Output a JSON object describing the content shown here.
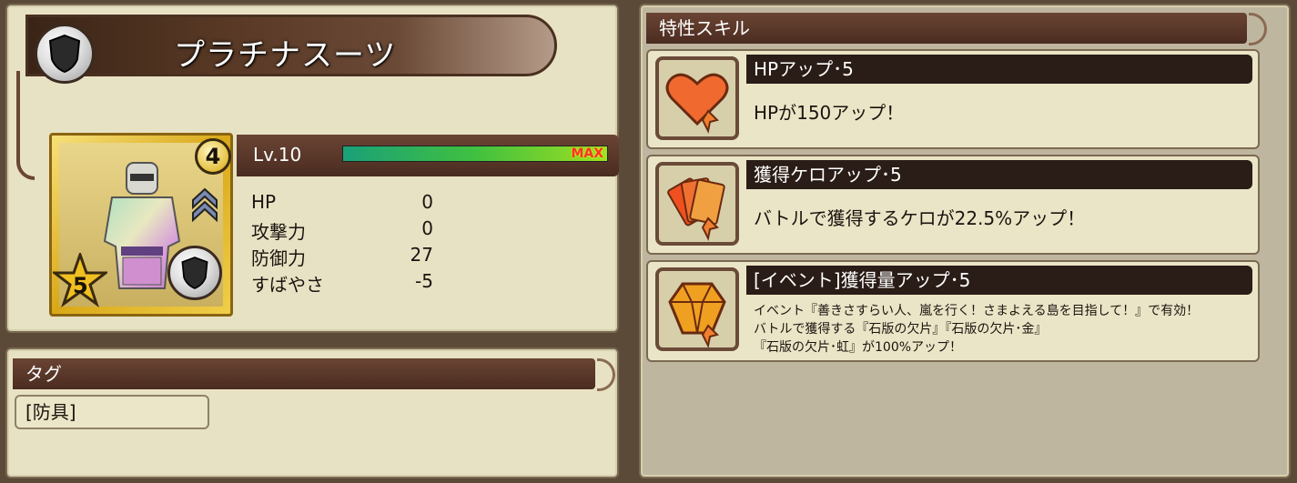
{
  "item": {
    "name": "プラチナスーツ",
    "level": "Lv.10",
    "max_label": "MAX",
    "exp_fraction": 1.0,
    "rank": "4",
    "stars": "5",
    "stats": [
      {
        "label": "HP",
        "value": "0"
      },
      {
        "label": "攻撃力",
        "value": "0"
      },
      {
        "label": "防御力",
        "value": "27"
      },
      {
        "label": "すばやさ",
        "value": "-5"
      }
    ]
  },
  "tags": {
    "header": "タグ",
    "items": [
      "[防具]"
    ]
  },
  "skills": {
    "header": "特性スキル",
    "items": [
      {
        "title": "HPアップ･5",
        "desc": "HPが150アップ！",
        "icon": "heart-icon"
      },
      {
        "title": "獲得ケロアップ･5",
        "desc": "バトルで獲得するケロが22.5%アップ！",
        "icon": "cards-icon"
      },
      {
        "title": "[イベント]獲得量アップ･5",
        "desc_lines": [
          "イベント『善きさすらい人、嵐を行く！さまよえる島を目指して！』で有効！",
          "バトルで獲得する『石版の欠片』『石版の欠片･金』",
          "『石版の欠片･虹』が100%アップ！"
        ],
        "icon": "gem-icon"
      }
    ]
  },
  "colors": {
    "panel": "#e8e2c4",
    "header": "#4a2c20",
    "max": "#ff3030",
    "exp_bar": "#40c040"
  }
}
